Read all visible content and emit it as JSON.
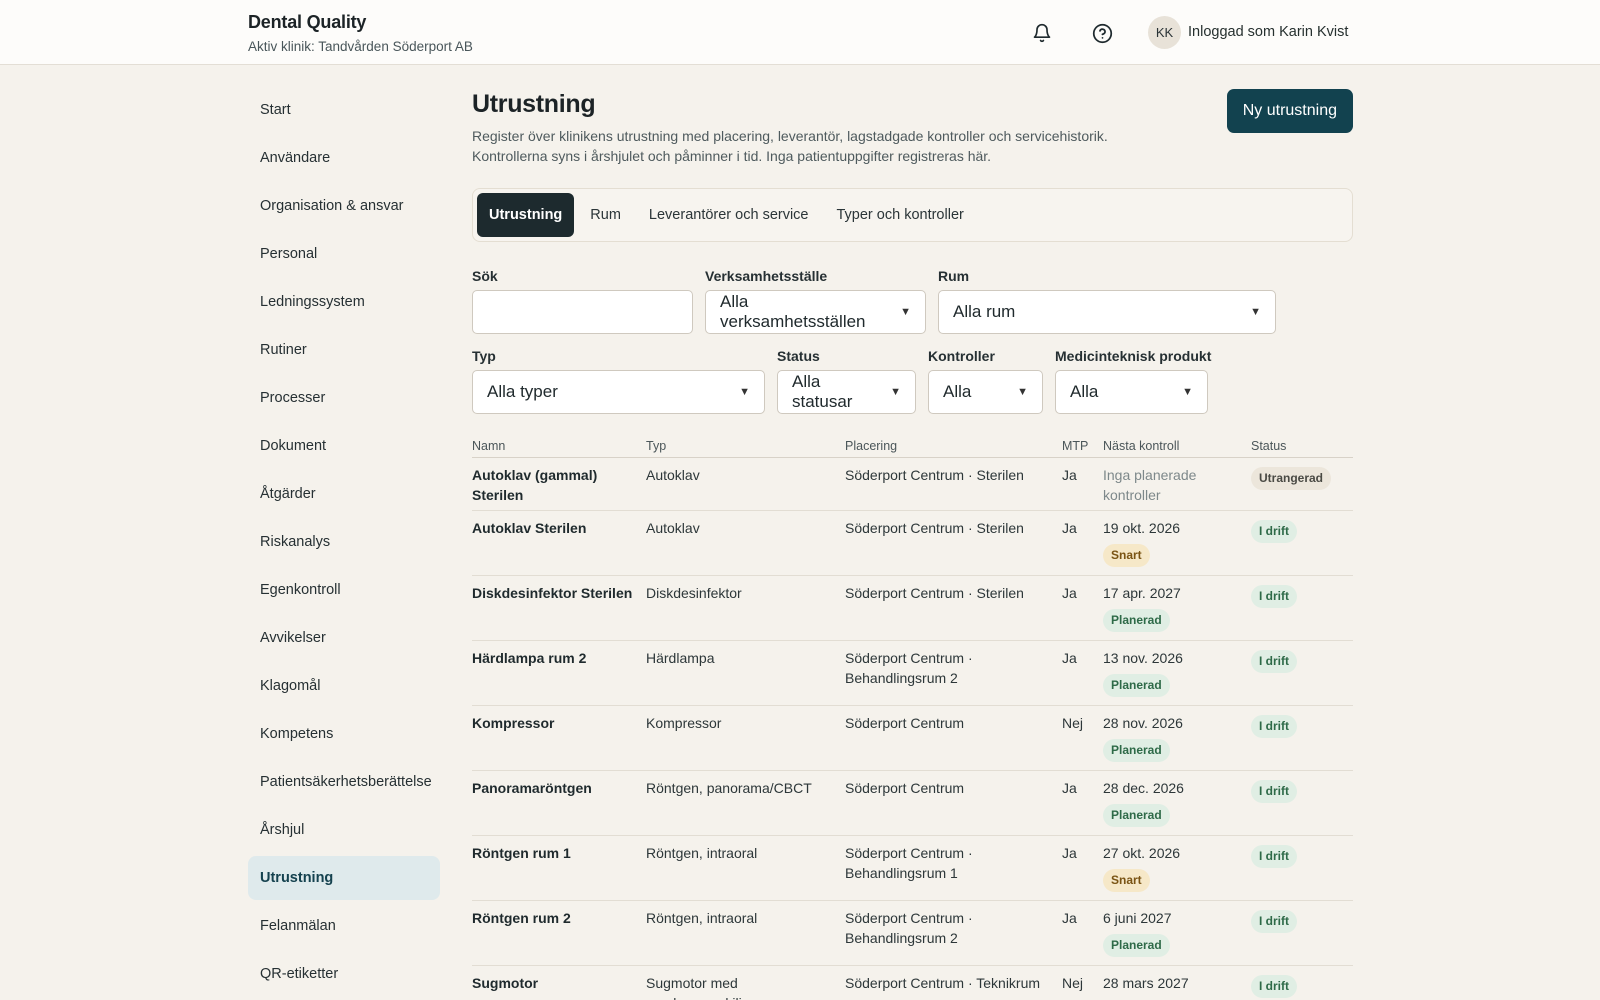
{
  "header": {
    "title": "Dental Quality",
    "subtitle": "Aktiv klinik: Tandvården Söderport AB",
    "avatar_initials": "KK",
    "user_label": "Inloggad som Karin Kvist"
  },
  "sidebar": {
    "items": [
      {
        "label": "Start"
      },
      {
        "label": "Användare"
      },
      {
        "label": "Organisation & ansvar"
      },
      {
        "label": "Personal"
      },
      {
        "label": "Ledningssystem"
      },
      {
        "label": "Rutiner"
      },
      {
        "label": "Processer"
      },
      {
        "label": "Dokument"
      },
      {
        "label": "Åtgärder"
      },
      {
        "label": "Riskanalys"
      },
      {
        "label": "Egenkontroll"
      },
      {
        "label": "Avvikelser"
      },
      {
        "label": "Klagomål"
      },
      {
        "label": "Kompetens"
      },
      {
        "label": "Patientsäkerhetsberättelse"
      },
      {
        "label": "Årshjul"
      },
      {
        "label": "Utrustning"
      },
      {
        "label": "Felanmälan"
      },
      {
        "label": "QR-etiketter"
      }
    ],
    "active_index": 16
  },
  "page": {
    "title": "Utrustning",
    "description_line1": "Register över klinikens utrustning med placering, leverantör, lagstadgade kontroller och servicehistorik.",
    "description_line2": "Kontrollerna syns i årshjulet och påminner i tid. Inga patientuppgifter registreras här.",
    "new_button": "Ny utrustning"
  },
  "tabs": [
    {
      "label": "Utrustning",
      "active": true
    },
    {
      "label": "Rum"
    },
    {
      "label": "Leverantörer och service"
    },
    {
      "label": "Typer och kontroller"
    }
  ],
  "filters": {
    "search_label": "Sök",
    "search_value": "",
    "site_label": "Verksamhetsställe",
    "site_value": "Alla verksamhetsställen",
    "room_label": "Rum",
    "room_value": "Alla rum",
    "type_label": "Typ",
    "type_value": "Alla typer",
    "status_label": "Status",
    "status_value": "Alla statusar",
    "controls_label": "Kontroller",
    "controls_value": "Alla",
    "mtp_label": "Medicinteknisk produkt",
    "mtp_value": "Alla"
  },
  "table": {
    "headers": [
      "Namn",
      "Typ",
      "Placering",
      "MTP",
      "Nästa kontroll",
      "Status"
    ],
    "rows": [
      {
        "name": "Autoklav (gammal) Sterilen",
        "type": "Autoklav",
        "place": "Söderport Centrum · Sterilen",
        "mtp": "Ja",
        "next": "Inga planerade kontroller",
        "next_badge": "",
        "status": "Utrangerad"
      },
      {
        "name": "Autoklav Sterilen",
        "type": "Autoklav",
        "place": "Söderport Centrum · Sterilen",
        "mtp": "Ja",
        "next": "19 okt. 2026",
        "next_badge": "Snart",
        "status": "I drift"
      },
      {
        "name": "Diskdesinfektor Sterilen",
        "type": "Diskdesinfektor",
        "place": "Söderport Centrum · Sterilen",
        "mtp": "Ja",
        "next": "17 apr. 2027",
        "next_badge": "Planerad",
        "status": "I drift"
      },
      {
        "name": "Härdlampa rum 2",
        "type": "Härdlampa",
        "place": "Söderport Centrum · Behandlingsrum 2",
        "mtp": "Ja",
        "next": "13 nov. 2026",
        "next_badge": "Planerad",
        "status": "I drift"
      },
      {
        "name": "Kompressor",
        "type": "Kompressor",
        "place": "Söderport Centrum",
        "mtp": "Nej",
        "next": "28 nov. 2026",
        "next_badge": "Planerad",
        "status": "I drift"
      },
      {
        "name": "Panoramaröntgen",
        "type": "Röntgen, panorama/CBCT",
        "place": "Söderport Centrum",
        "mtp": "Ja",
        "next": "28 dec. 2026",
        "next_badge": "Planerad",
        "status": "I drift"
      },
      {
        "name": "Röntgen rum 1",
        "type": "Röntgen, intraoral",
        "place": "Söderport Centrum · Behandlingsrum 1",
        "mtp": "Ja",
        "next": "27 okt. 2026",
        "next_badge": "Snart",
        "status": "I drift"
      },
      {
        "name": "Röntgen rum 2",
        "type": "Röntgen, intraoral",
        "place": "Söderport Centrum · Behandlingsrum 2",
        "mtp": "Ja",
        "next": "6 juni 2027",
        "next_badge": "Planerad",
        "status": "I drift"
      },
      {
        "name": "Sugmotor",
        "type": "Sugmotor med amalgamavskiljare",
        "place": "Söderport Centrum · Teknikrum",
        "mtp": "Nej",
        "next": "28 mars 2027",
        "next_badge": "",
        "status": "I drift"
      }
    ]
  },
  "colors": {
    "primary": "#12424f",
    "background": "#f5f2ec",
    "active_nav_bg": "#dfeaec",
    "badge_ok_bg": "#e0eee4",
    "badge_soon_bg": "#f6e8c8"
  }
}
